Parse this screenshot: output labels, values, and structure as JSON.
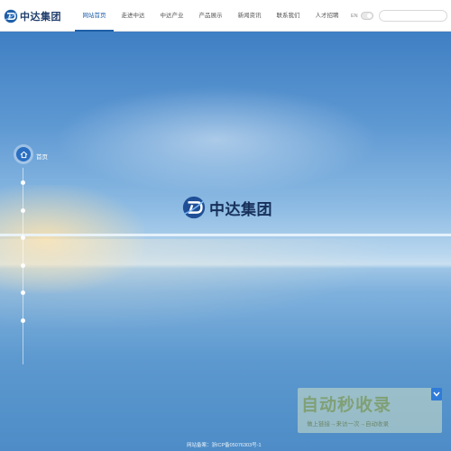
{
  "header": {
    "logo_text": "中达集团",
    "nav": [
      {
        "label": "网站首页",
        "active": true
      },
      {
        "label": "走进中达",
        "active": false
      },
      {
        "label": "中达产业",
        "active": false
      },
      {
        "label": "产品展示",
        "active": false
      },
      {
        "label": "新闻资讯",
        "active": false
      },
      {
        "label": "联系我们",
        "active": false
      },
      {
        "label": "人才招聘",
        "active": false
      }
    ],
    "lang_label": "EN",
    "search_value": ""
  },
  "hero": {
    "brand_text": "中达集团"
  },
  "side_nav": {
    "home_label": "首页",
    "dot_count": 6
  },
  "footer": {
    "icp_text": "网站备案：浙ICP备05076303号-1"
  },
  "watermark": {
    "title": "自动秒收录",
    "subtitle": "做上链接→来访一次→自动收录"
  },
  "colors": {
    "accent": "#1f5fa8",
    "brand_dark": "#16305a"
  }
}
